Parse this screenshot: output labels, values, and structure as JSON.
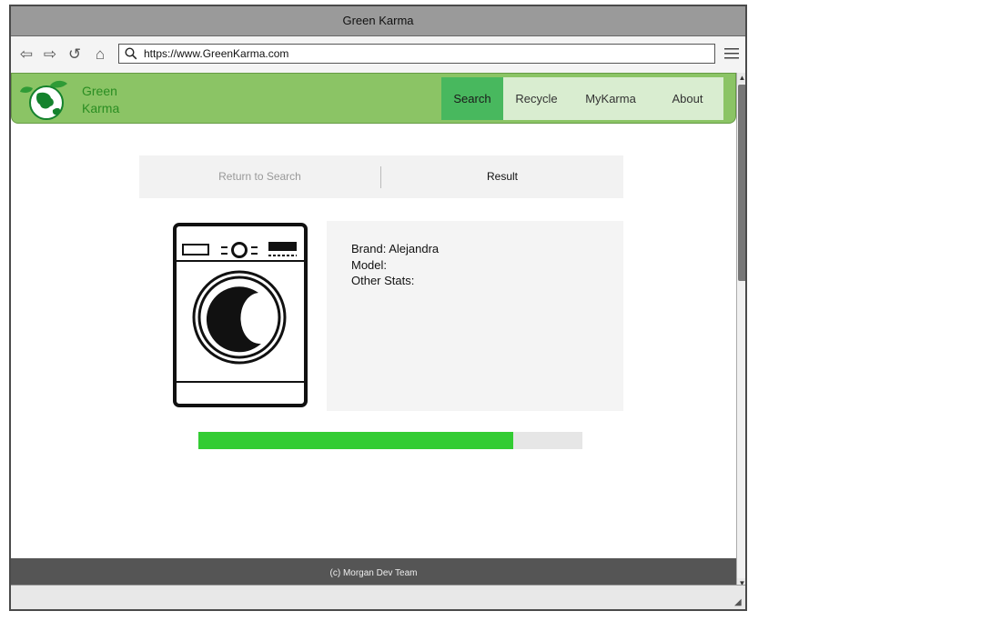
{
  "browser": {
    "title": "Green Karma",
    "url": "https://www.GreenKarma.com"
  },
  "site": {
    "brand": {
      "line1": "Green",
      "line2": "Karma"
    },
    "nav": [
      {
        "label": "Search",
        "active": true
      },
      {
        "label": "Recycle",
        "active": false
      },
      {
        "label": "MyKarma",
        "active": false
      },
      {
        "label": "About",
        "active": false
      }
    ]
  },
  "results": {
    "return_label": "Return to Search",
    "result_label": "Result"
  },
  "product": {
    "brand_line": "Brand: Alejandra",
    "model_line": "Model:",
    "stats_line": "Other Stats:"
  },
  "progress": {
    "fraction": 0.82
  },
  "footer": {
    "text": "(c) Morgan Dev Team"
  },
  "colors": {
    "header_bg": "#8bc465",
    "brand_text": "#2a8d22",
    "active_tab": "#48b85e",
    "progress_fill": "#33cc33",
    "footer_bg": "#555555"
  },
  "icons": {
    "back": "back-arrow-icon",
    "forward": "forward-arrow-icon",
    "reload": "reload-icon",
    "home": "home-icon",
    "search": "search-icon",
    "menu": "hamburger-menu-icon",
    "logo": "green-earth-leaf-logo",
    "product": "washing-machine-icon"
  }
}
